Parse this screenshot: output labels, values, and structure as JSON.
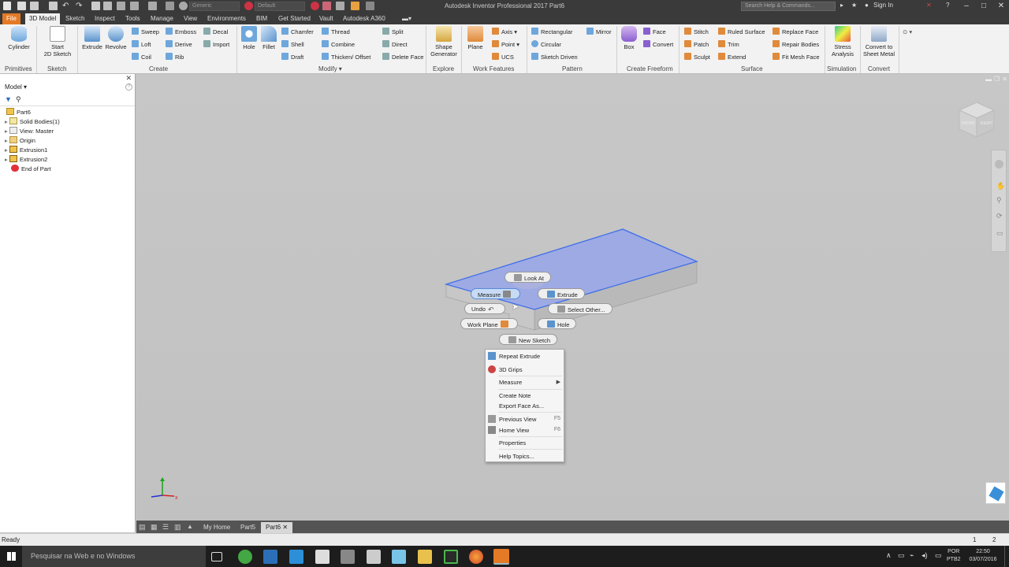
{
  "title_bar": {
    "app_title": "Autodesk Inventor Professional 2017   Part6",
    "material": "Generic",
    "appearance": "Default",
    "search_placeholder": "Search Help & Commands...",
    "sign_in": "Sign In"
  },
  "ribbon_tabs": [
    "File",
    "3D Model",
    "Sketch",
    "Inspect",
    "Tools",
    "Manage",
    "View",
    "Environments",
    "BIM",
    "Get Started",
    "Vault",
    "Autodesk A360"
  ],
  "ribbon": {
    "primitives": {
      "title": "Primitives",
      "cylinder": "Cylinder"
    },
    "sketch": {
      "title": "Sketch",
      "start_line1": "Start",
      "start_line2": "2D Sketch"
    },
    "create": {
      "title": "Create",
      "extrude": "Extrude",
      "revolve": "Revolve",
      "sweep": "Sweep",
      "loft": "Loft",
      "coil": "Coil",
      "emboss": "Emboss",
      "derive": "Derive",
      "rib": "Rib",
      "decal": "Decal",
      "import": "Import"
    },
    "modify": {
      "title": "Modify",
      "hole": "Hole",
      "fillet": "Fillet",
      "chamfer": "Chamfer",
      "shell": "Shell",
      "draft": "Draft",
      "thread": "Thread",
      "combine": "Combine",
      "thicken": "Thicken/ Offset",
      "split": "Split",
      "direct": "Direct",
      "delete_face": "Delete Face"
    },
    "explore": {
      "title": "Explore",
      "shape_line1": "Shape",
      "shape_line2": "Generator"
    },
    "work_features": {
      "title": "Work Features",
      "plane": "Plane",
      "axis": "Axis",
      "point": "Point",
      "ucs": "UCS"
    },
    "pattern": {
      "title": "Pattern",
      "rectangular": "Rectangular",
      "circular": "Circular",
      "sketch_driven": "Sketch Driven",
      "mirror": "Mirror"
    },
    "freeform": {
      "title": "Create Freeform",
      "box": "Box",
      "face": "Face",
      "convert": "Convert"
    },
    "surface": {
      "title": "Surface",
      "stitch": "Stitch",
      "patch": "Patch",
      "sculpt": "Sculpt",
      "ruled_surface": "Ruled Surface",
      "trim": "Trim",
      "extend": "Extend",
      "replace_face": "Replace Face",
      "repair_bodies": "Repair Bodies",
      "fit_mesh_face": "Fit Mesh Face"
    },
    "simulation": {
      "title": "Simulation",
      "stress_line1": "Stress",
      "stress_line2": "Analysis"
    },
    "convert": {
      "title": "Convert",
      "sheet_line1": "Convert to",
      "sheet_line2": "Sheet Metal"
    }
  },
  "browser": {
    "header": "Model",
    "tree": [
      "Part6",
      "Solid Bodies(1)",
      "View: Master",
      "Origin",
      "Extrusion1",
      "Extrusion2",
      "End of Part"
    ]
  },
  "viewcube": {
    "front": "FRONT",
    "right": "RIGHT"
  },
  "marking_menu": {
    "look_at": "Look At",
    "measure": "Measure",
    "extrude": "Extrude",
    "undo": "Undo",
    "select_other": "Select Other...",
    "work_plane": "Work Plane",
    "hole": "Hole",
    "new_sketch": "New Sketch"
  },
  "context_menu": {
    "repeat_extrude": "Repeat Extrude",
    "grips_3d": "3D Grips",
    "measure": "Measure",
    "create_note": "Create Note",
    "export_face": "Export Face As...",
    "previous_view": "Previous View",
    "previous_view_key": "F5",
    "home_view": "Home View",
    "home_view_key": "F6",
    "properties": "Properties",
    "help_topics": "Help Topics..."
  },
  "doc_tabs": {
    "my_home": "My Home",
    "part5": "Part5",
    "part6": "Part6"
  },
  "status": {
    "text": "Ready",
    "count1": "1",
    "count2": "2"
  },
  "taskbar": {
    "search": "Pesquisar na Web e no Windows",
    "lang1": "POR",
    "lang2": "PTB2",
    "time": "22:50",
    "date": "03/07/2016"
  },
  "colors": {
    "accent": "#e47a25",
    "selection": "#8f9ff0",
    "ribbon_bg": "#f2f2f2",
    "viewport": "#c4c4c4"
  }
}
